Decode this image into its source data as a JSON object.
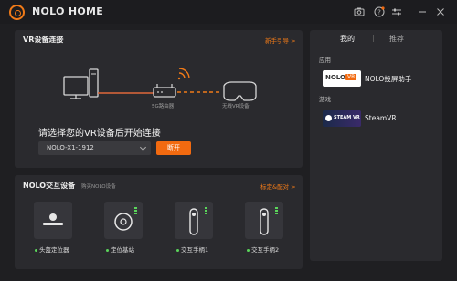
{
  "window": {
    "title": "NOLO HOME",
    "icons": [
      "screenshot-icon",
      "help-icon",
      "settings-sliders-icon",
      "minimize-icon",
      "close-icon"
    ]
  },
  "vr": {
    "title": "VR设备连接",
    "guide_link": "新手引导 >",
    "router_label": "5G路由器",
    "headset_label": "无线VR设备",
    "prompt": "请选择您的VR设备后开始连接",
    "device_select_value": "NOLO-X1-1912",
    "disconnect_label": "断开"
  },
  "devices": {
    "title": "NOLO交互设备",
    "buy_link": "购买NOLO设备",
    "pair_link": "标定&配对 >",
    "items": [
      {
        "name": "头盔定位器",
        "status_color": "#5ad65a"
      },
      {
        "name": "定位基站",
        "status_color": "#5ad65a"
      },
      {
        "name": "交互手柄1",
        "status_color": "#5ad65a"
      },
      {
        "name": "交互手柄2",
        "status_color": "#5ad65a"
      }
    ]
  },
  "right": {
    "tabs": [
      "我的",
      "推荐"
    ],
    "app_category": "应用",
    "app_name": "NOLO投屏助手",
    "app_badge_text": "NOLO",
    "app_badge_tag": "VR",
    "game_category": "游戏",
    "game_name": "SteamVR",
    "game_badge_text": "STEAM VR"
  },
  "colors": {
    "accent": "#f26a10",
    "background": "#1f1f22",
    "panel": "#2a2a2e",
    "status_ok": "#5ad65a"
  }
}
